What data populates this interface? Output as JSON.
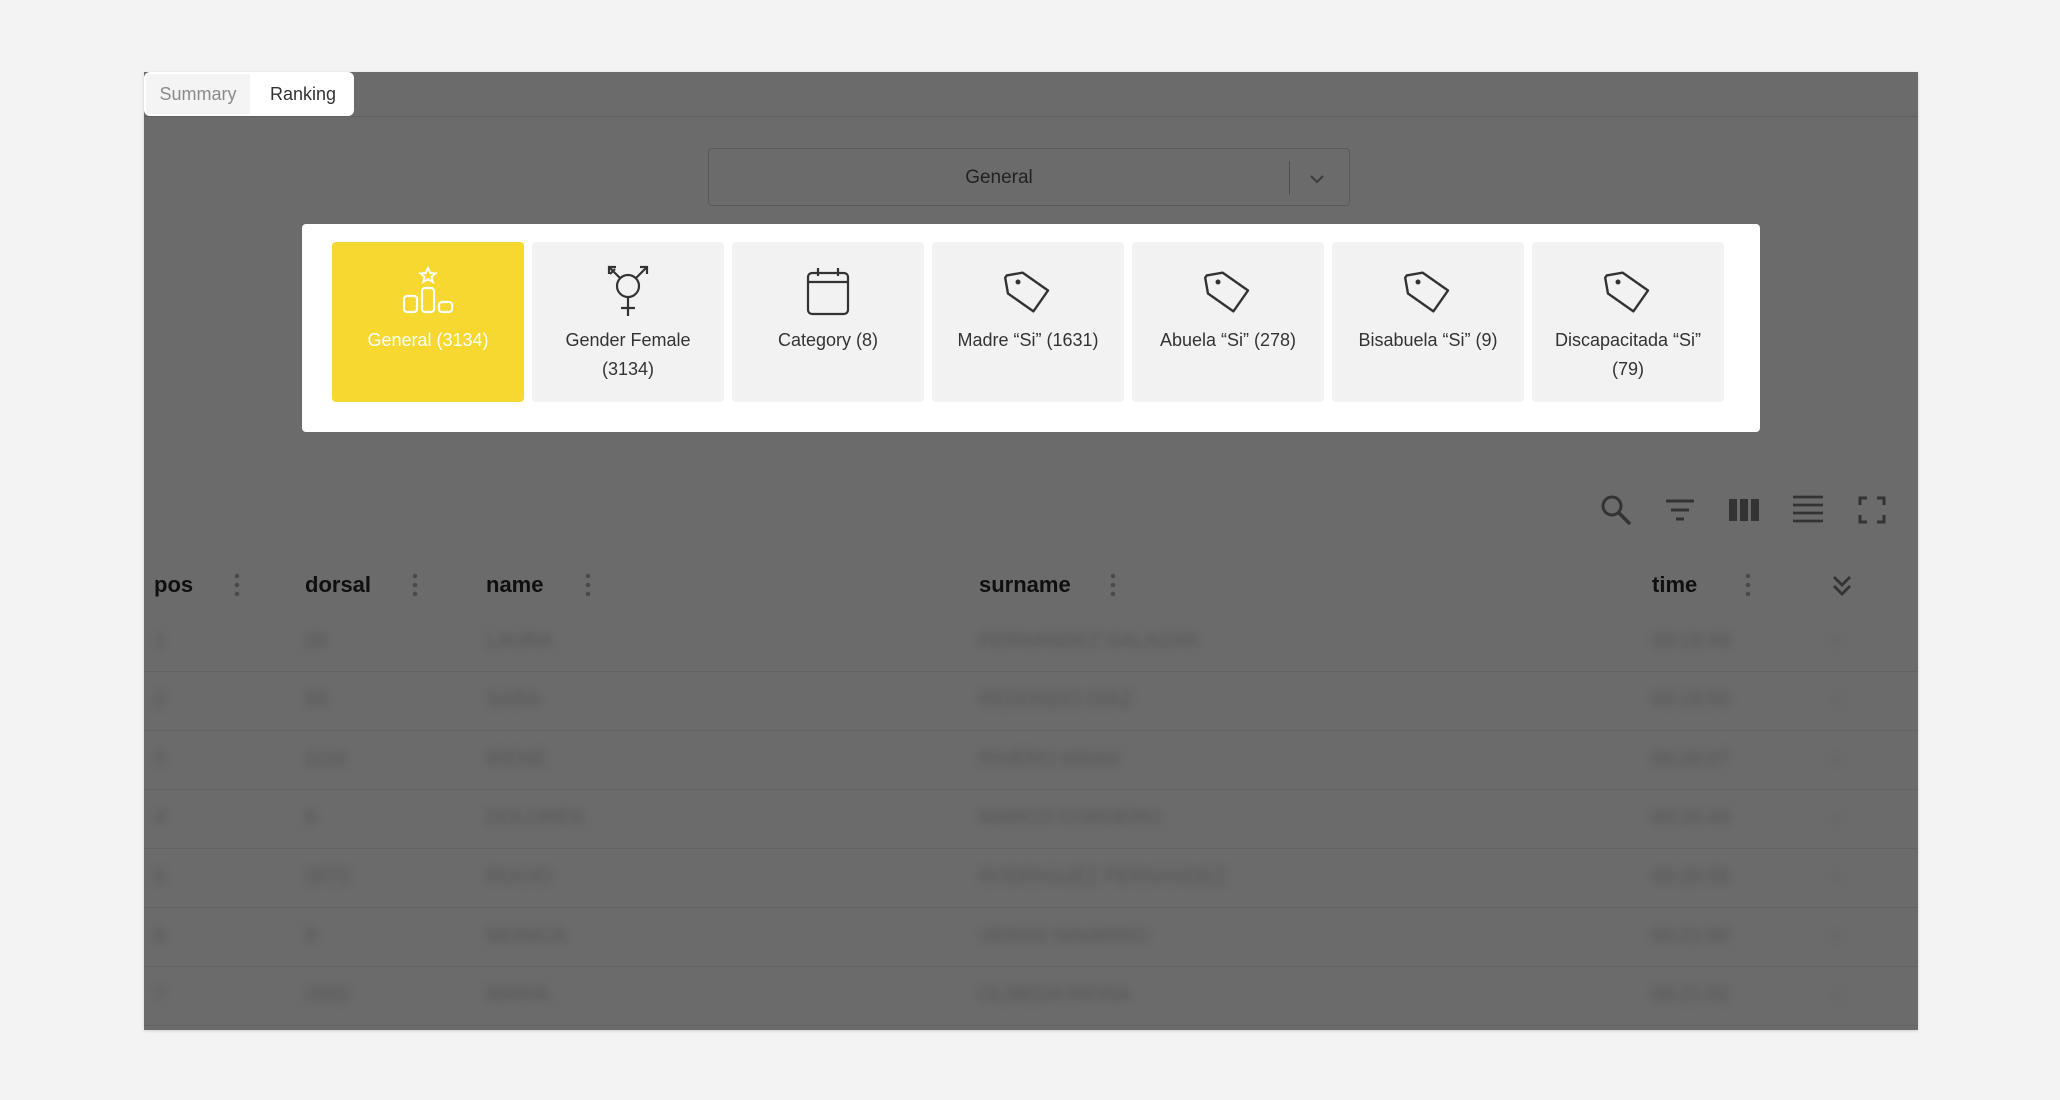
{
  "tabs": [
    {
      "label": "Summary"
    },
    {
      "label": "Ranking"
    }
  ],
  "ranking_select": {
    "value": "General"
  },
  "filter_chips": [
    {
      "label": "General (3134)",
      "icon": "podium-icon",
      "active": true
    },
    {
      "label": "Gender Female (3134)",
      "icon": "gender-icon",
      "active": false
    },
    {
      "label": "Category (8)",
      "icon": "calendar-icon",
      "active": false
    },
    {
      "label": "Madre “Si” (1631)",
      "icon": "tag-icon",
      "active": false
    },
    {
      "label": "Abuela “Si” (278)",
      "icon": "tag-icon",
      "active": false
    },
    {
      "label": "Bisabuela “Si” (9)",
      "icon": "tag-icon",
      "active": false
    },
    {
      "label": "Discapacitada “Si” (79)",
      "icon": "tag-icon",
      "active": false
    }
  ],
  "toolbar": [
    "search-icon",
    "filter-icon",
    "columns-icon",
    "density-icon",
    "fullscreen-icon"
  ],
  "table": {
    "columns": [
      "pos",
      "dorsal",
      "name",
      "surname",
      "time"
    ],
    "rows": [
      {
        "pos": "1",
        "dorsal": "20",
        "name": "LAURA",
        "surname": "FERNANDEZ SALAZAR",
        "time": "00:19:49"
      },
      {
        "pos": "2",
        "dorsal": "93",
        "name": "SARA",
        "surname": "REDONDO DIAZ",
        "time": "00:19:50"
      },
      {
        "pos": "3",
        "dorsal": "1116",
        "name": "IRENE",
        "surname": "RIVERO ARIAS",
        "time": "00:20:07"
      },
      {
        "pos": "4",
        "dorsal": "8",
        "name": "DOLORES",
        "surname": "MARCO CORDERO",
        "time": "00:20:49"
      },
      {
        "pos": "5",
        "dorsal": "2072",
        "name": "ROCIO",
        "surname": "RODRIGUEZ FERNANDEZ",
        "time": "00:20:56"
      },
      {
        "pos": "6",
        "dorsal": "9",
        "name": "MONICA",
        "surname": "VERAS NAVARRO",
        "time": "00:21:00"
      },
      {
        "pos": "7",
        "dorsal": "2082",
        "name": "MARIA",
        "surname": "OLMEDA RIOSA",
        "time": "00:21:02"
      }
    ]
  },
  "colors": {
    "active_chip": "#f6d830",
    "overlay": "#6b6b6b"
  }
}
